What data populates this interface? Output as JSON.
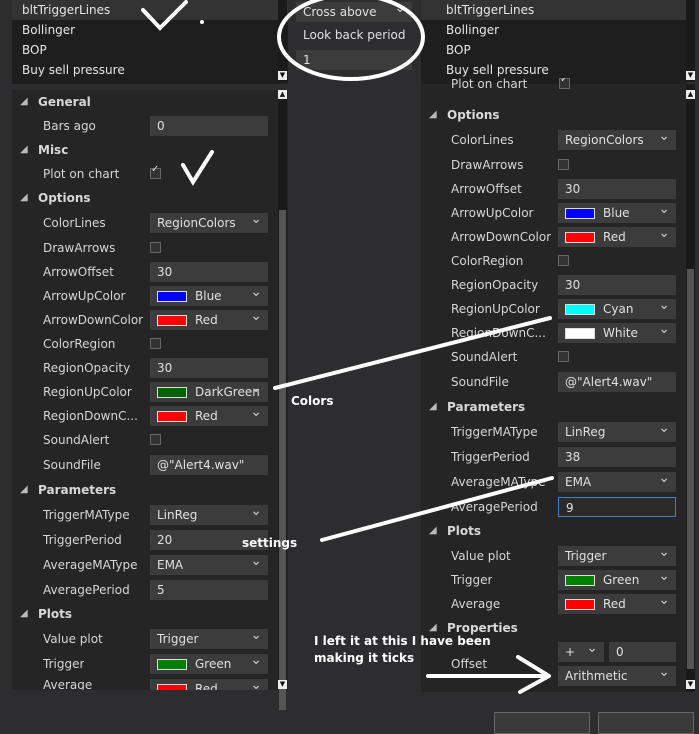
{
  "left_list": [
    "bltTriggerLines",
    "Bollinger",
    "BOP",
    "Buy sell pressure"
  ],
  "left": {
    "general": "General",
    "bars_ago_label": "Bars ago",
    "bars_ago": "0",
    "misc": "Misc",
    "plot_on_chart": "Plot on chart",
    "options": "Options",
    "rows": {
      "colorlines": "ColorLines",
      "colorlines_v": "RegionColors",
      "drawarrows": "DrawArrows",
      "arrowoffset": "ArrowOffset",
      "arrowoffset_v": "30",
      "arrowup": "ArrowUpColor",
      "arrowup_v": "Blue",
      "arrowdown": "ArrowDownColor",
      "arrowdown_v": "Red",
      "colorregion": "ColorRegion",
      "regionopacity": "RegionOpacity",
      "regionopacity_v": "30",
      "regionup": "RegionUpColor",
      "regionup_v": "DarkGreen",
      "regiondown": "RegionDownC...",
      "regiondown_v": "Red",
      "soundalert": "SoundAlert",
      "soundfile": "SoundFile",
      "soundfile_v": "@\"Alert4.wav\""
    },
    "parameters": "Parameters",
    "params": {
      "trigmatype": "TriggerMAType",
      "trigmatype_v": "LinReg",
      "trigperiod": "TriggerPeriod",
      "trigperiod_v": "20",
      "avgmatype": "AverageMAType",
      "avgmatype_v": "EMA",
      "avgperiod": "AveragePeriod",
      "avgperiod_v": "5"
    },
    "plots": "Plots",
    "plot_rows": {
      "valueplot": "Value plot",
      "valueplot_v": "Trigger",
      "trigger": "Trigger",
      "trigger_v": "Green",
      "average": "Average",
      "average_v": "Red"
    }
  },
  "middle": {
    "cross": "Cross above",
    "lookback": "Look back period",
    "lookback_v": "1"
  },
  "right_list": [
    "bltTriggerLines",
    "Bollinger",
    "BOP",
    "Buy sell pressure"
  ],
  "right": {
    "plot_on_chart": "Plot on chart",
    "options": "Options",
    "rows": {
      "colorlines": "ColorLines",
      "colorlines_v": "RegionColors",
      "drawarrows": "DrawArrows",
      "arrowoffset": "ArrowOffset",
      "arrowoffset_v": "30",
      "arrowup": "ArrowUpColor",
      "arrowup_v": "Blue",
      "arrowdown": "ArrowDownColor",
      "arrowdown_v": "Red",
      "colorregion": "ColorRegion",
      "regionopacity": "RegionOpacity",
      "regionopacity_v": "30",
      "regionup": "RegionUpColor",
      "regionup_v": "Cyan",
      "regiondown": "RegionDownC...",
      "regiondown_v": "White",
      "soundalert": "SoundAlert",
      "soundfile": "SoundFile",
      "soundfile_v": "@\"Alert4.wav\""
    },
    "parameters": "Parameters",
    "params": {
      "trigmatype": "TriggerMAType",
      "trigmatype_v": "LinReg",
      "trigperiod": "TriggerPeriod",
      "trigperiod_v": "38",
      "avgmatype": "AverageMAType",
      "avgmatype_v": "EMA",
      "avgperiod": "AveragePeriod",
      "avgperiod_v": "9"
    },
    "plots": "Plots",
    "plot_rows": {
      "valueplot": "Value plot",
      "valueplot_v": "Trigger",
      "trigger": "Trigger",
      "trigger_v": "Green",
      "average": "Average",
      "average_v": "Red"
    },
    "properties": "Properties",
    "offset": "Offset",
    "offset_sign": "+",
    "offset_v": "0",
    "scale_v": "Arithmetic"
  },
  "annotations": {
    "colors": "Colors",
    "settings": "settings",
    "note_line1": "I left it at this I have been",
    "note_line2": "making it ticks"
  },
  "colors": {
    "blue": "#0000ff",
    "red": "#ff0000",
    "darkgreen": "#006400",
    "cyan": "#00ffff",
    "white": "#ffffff",
    "green": "#008000"
  }
}
